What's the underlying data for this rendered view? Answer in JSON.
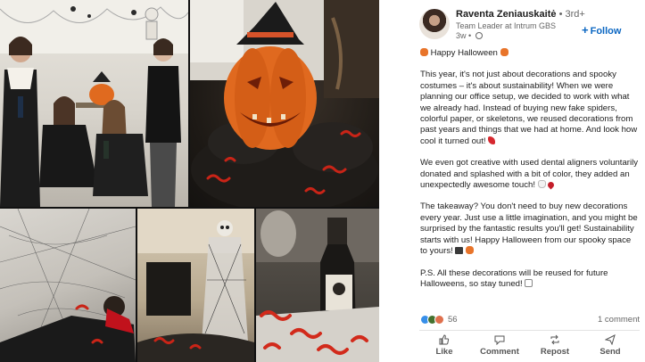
{
  "author": {
    "name": "Raventa Zeniauskaitė",
    "degree": "• 3rd+",
    "title": "Team Leader at Intrum GBS",
    "time": "3w •"
  },
  "follow_label": "Follow",
  "post": {
    "greeting": "Happy Halloween",
    "paragraph1": "This year, it's not just about decorations and spooky costumes – it's about sustainability! When we were planning our office setup, we decided to work with what we already had. Instead of buying new fake spiders, colorful paper, or skeletons, we reused decorations from past years and things that we had at home. And look how cool it turned out!",
    "paragraph2": "We even got creative with used dental aligners voluntarily donated and splashed with a bit of color, they added an unexpectedly awesome touch!",
    "paragraph3": "The takeaway? You don't need to buy new decorations every year. Just use a little imagination, and you might be surprised by the fantastic results you'll get! Sustainability starts with us! Happy Halloween from our spooky space to yours!",
    "paragraph4": "P.S. All these decorations will be reused for future Halloweens, so stay tuned!"
  },
  "reactions": {
    "count": "56",
    "comments": "1 comment"
  },
  "actions": {
    "like": "Like",
    "comment": "Comment",
    "repost": "Repost",
    "send": "Send"
  },
  "icons": {
    "greeting": "pumpkin-emoji",
    "follow": "plus-icon",
    "visibility": "globe-icon"
  }
}
